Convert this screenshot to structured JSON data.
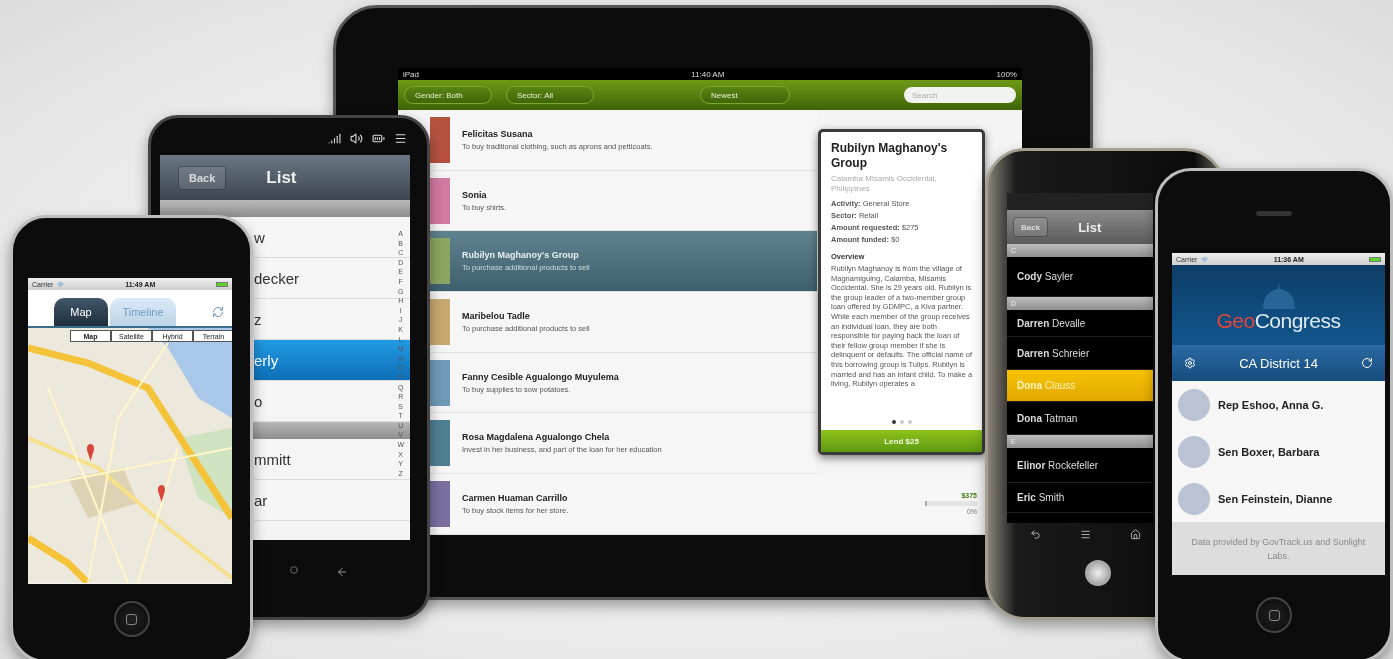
{
  "tablet": {
    "status": {
      "device": "iPad",
      "time": "11:40 AM",
      "battery": "100%"
    },
    "filters": [
      {
        "label": "Gender: Both"
      },
      {
        "label": "Sector: All"
      },
      {
        "label": "Newest"
      }
    ],
    "search": {
      "placeholder": "Search"
    },
    "loans": [
      {
        "name": "Felicitas Susana",
        "use": "To buy traditional clothing, such as aprons and petticoats.",
        "selected": false
      },
      {
        "name": "Sonia",
        "use": "To buy shirts.",
        "selected": false
      },
      {
        "name": "Rubilyn Maghanoy's Group",
        "use": "To purchase additional products to sell",
        "selected": true
      },
      {
        "name": "Maribelou Tadle",
        "use": "To purchase additional products to sell",
        "selected": false
      },
      {
        "name": "Fanny Cesible Agualongo Muyulema",
        "use": "To buy supplies to sow potatoes.",
        "selected": false
      },
      {
        "name": "Rosa Magdalena Agualongo Chela",
        "use": "Invest in her business, and part of the loan for her education",
        "selected": false
      },
      {
        "name": "Carmen Huaman Carrillo",
        "use": "To buy stock items for her store.",
        "selected": false,
        "amount": "$375",
        "percent": "0%",
        "level": 0
      }
    ],
    "detail": {
      "title": "Rubilyn Maghanoy's Group",
      "location": "Calamba Misamis Occidental, Philippines",
      "facts": [
        "**Activity:** General Store",
        "**Sector:** Retail",
        "**Amount requested:** $275",
        "**Amount funded:** $0"
      ],
      "overview_heading": "Overview",
      "overview": "Rubilyn Maghanoy is from the village of Magnamiguing, Calamba, Misamis Occidental. She is 29 years old. Rubilyn is the group leader of a two-member group loan offered by GDMPC, a Kiva partner. While each member of the group receives an individual loan, they are both responsible for paying back the loan of their fellow group member if she is delinquent or defaults. The official name of this borrowing group is Tulips. Rubilyn is married and has an infant child. To make a living, Rubilyn operates a",
      "pages": [
        {
          "selected": true
        },
        {
          "selected": false
        },
        {
          "selected": false
        }
      ],
      "button": "Lend $25"
    }
  },
  "htc": {
    "nav": {
      "back": "Back",
      "title": "List"
    },
    "rows": [
      {
        "kind": "section"
      },
      {
        "kind": "item",
        "text": "w",
        "selected": false
      },
      {
        "kind": "item",
        "text": "decker",
        "selected": false
      },
      {
        "kind": "item",
        "text": "z",
        "selected": false
      },
      {
        "kind": "item",
        "text": "erly",
        "selected": true
      },
      {
        "kind": "item",
        "text": "o",
        "selected": false
      },
      {
        "kind": "section"
      },
      {
        "kind": "item",
        "text": "mmitt",
        "selected": false
      },
      {
        "kind": "item",
        "text": "ar",
        "selected": false
      }
    ],
    "index": [
      "A",
      "B",
      "C",
      "D",
      "E",
      "F",
      "G",
      "H",
      "I",
      "J",
      "K",
      "L",
      "M",
      "N",
      "O",
      "P",
      "Q",
      "R",
      "S",
      "T",
      "U",
      "V",
      "W",
      "X",
      "Y",
      "Z"
    ]
  },
  "iphone_map": {
    "status": {
      "carrier": "Carrier",
      "time": "11:49 AM"
    },
    "tabs": [
      {
        "label": "Map",
        "selected": true
      },
      {
        "label": "Timeline",
        "selected": false
      }
    ],
    "map_types": [
      {
        "label": "Map",
        "selected": true
      },
      {
        "label": "Satellite",
        "selected": false
      },
      {
        "label": "Hybrid",
        "selected": false
      },
      {
        "label": "Terrain",
        "selected": false
      }
    ]
  },
  "nexus": {
    "nav": {
      "back": "Back",
      "title": "List"
    },
    "rows": [
      {
        "kind": "section",
        "text": "C"
      },
      {
        "kind": "item",
        "text": "**Cody** Sayler",
        "selected": false
      },
      {
        "kind": "section",
        "text": "D"
      },
      {
        "kind": "item",
        "text": "**Darren** Devalle",
        "selected": false
      },
      {
        "kind": "item",
        "text": "**Darren** Schreier",
        "selected": false
      },
      {
        "kind": "item",
        "text": "**Dona** Clauss",
        "selected": true
      },
      {
        "kind": "item",
        "text": "**Dona** Tatman",
        "selected": false
      },
      {
        "kind": "section",
        "text": "E"
      },
      {
        "kind": "item",
        "text": "**Elinor** Rockefeller",
        "selected": false
      },
      {
        "kind": "item",
        "text": "**Eric** Smith",
        "selected": false
      }
    ]
  },
  "iphone_congress": {
    "status": {
      "carrier": "Carrier",
      "time": "11:36 AM"
    },
    "brand": {
      "first": "Geo",
      "second": "Congress"
    },
    "district": "CA District 14",
    "members": [
      {
        "name": "Rep Eshoo, Anna G."
      },
      {
        "name": "Sen Boxer, Barbara"
      },
      {
        "name": "Sen Feinstein, Dianne"
      }
    ],
    "footer": "Data provided by GovTrack.us and Sunlight Labs."
  }
}
